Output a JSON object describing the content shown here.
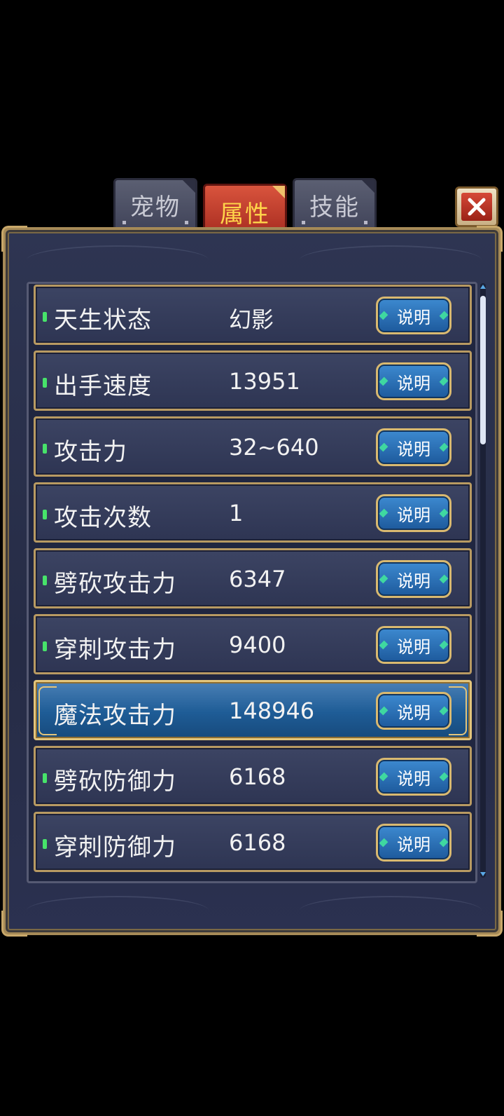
{
  "tabs": [
    {
      "label": "宠物",
      "active": false
    },
    {
      "label": "属性",
      "active": true
    },
    {
      "label": "技能",
      "active": false
    }
  ],
  "close_icon": "close-x-icon",
  "explain_label": "说明",
  "attributes": [
    {
      "label": "天生状态",
      "value": "幻影"
    },
    {
      "label": "出手速度",
      "value": "13951"
    },
    {
      "label": "攻击力",
      "value": "32~640"
    },
    {
      "label": "攻击次数",
      "value": "1"
    },
    {
      "label": "劈砍攻击力",
      "value": "6347"
    },
    {
      "label": "穿刺攻击力",
      "value": "9400"
    },
    {
      "label": "魔法攻击力",
      "value": "148946",
      "selected": true
    },
    {
      "label": "劈砍防御力",
      "value": "6168"
    },
    {
      "label": "穿刺防御力",
      "value": "6168"
    }
  ],
  "colors": {
    "active_tab_text": "#ffd54a",
    "selected_row": "#1e5c96",
    "bullet": "#47e36a"
  }
}
